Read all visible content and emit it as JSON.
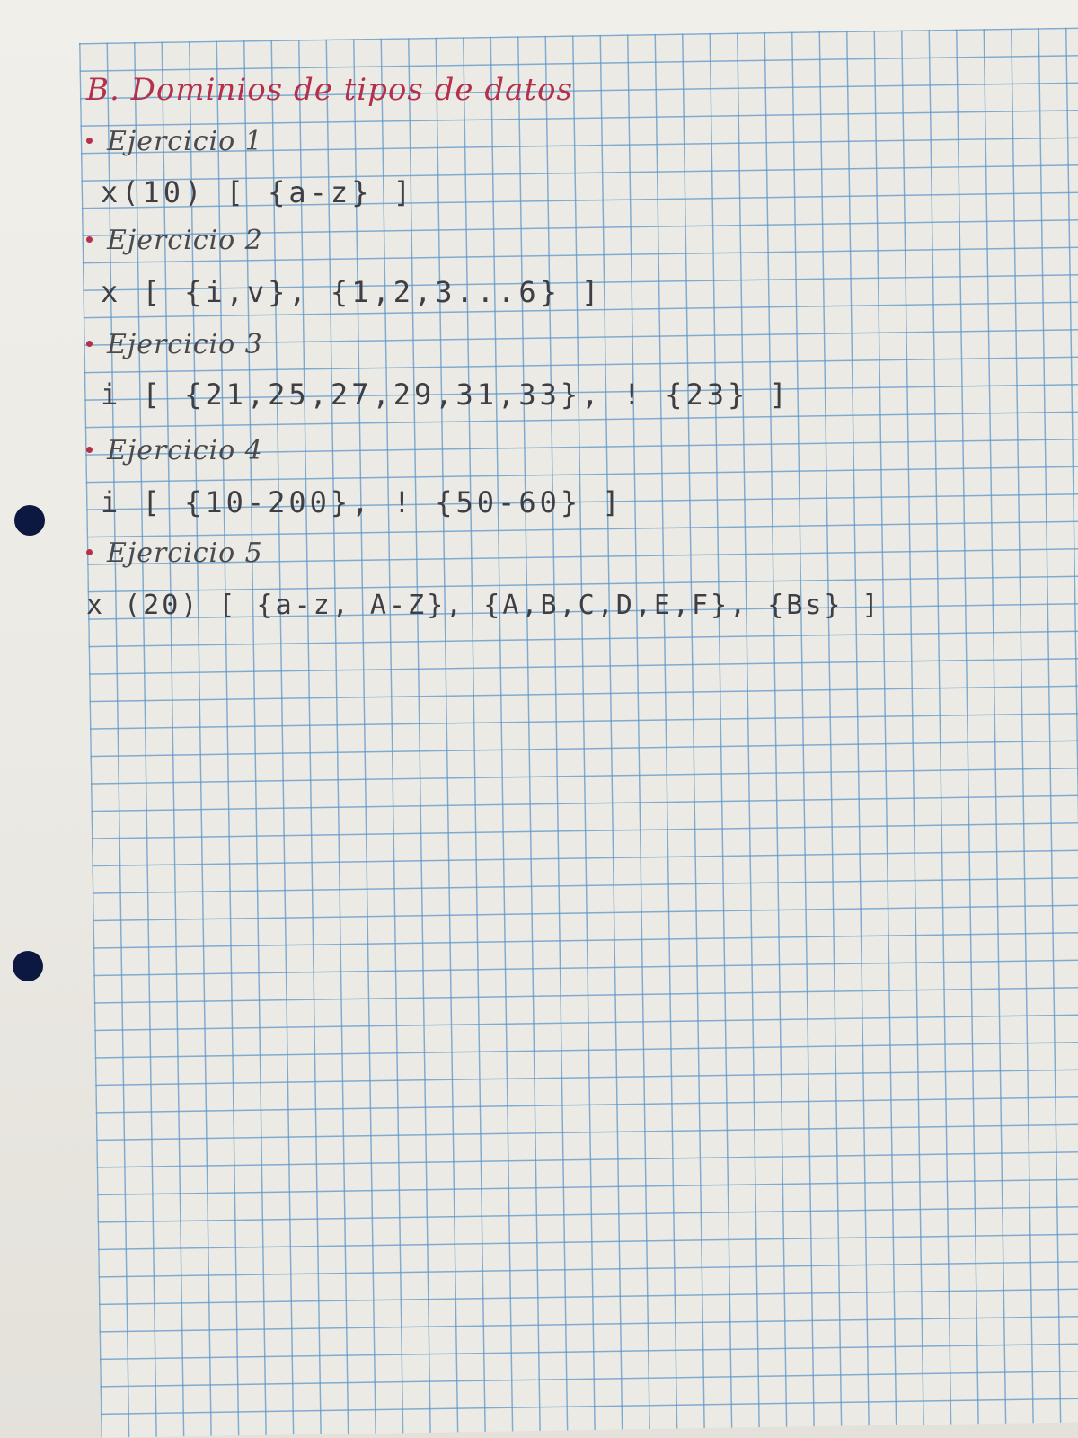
{
  "title": "B. Dominios de tipos de datos",
  "exercises": [
    {
      "heading": "Ejercicio 1",
      "formula": "x(10) [ {a-z} ]"
    },
    {
      "heading": "Ejercicio 2",
      "formula": "x [ {i,v}, {1,2,3...6} ]"
    },
    {
      "heading": "Ejercicio 3",
      "formula": "i [ {21,25,27,29,31,33}, ! {23} ]"
    },
    {
      "heading": "Ejercicio 4",
      "formula": "i [ {10-200}, ! {50-60} ]"
    },
    {
      "heading": "Ejercicio 5",
      "formula": "x (20) [ {a-z, A-Z}, {A,B,C,D,E,F}, {Bs} ]"
    }
  ],
  "colors": {
    "title_ink": "#b5304a",
    "text_ink": "#3e3e44",
    "grid_line": "#5c96c8",
    "paper": "#eceae5",
    "punch_hole": "#0c1840"
  }
}
